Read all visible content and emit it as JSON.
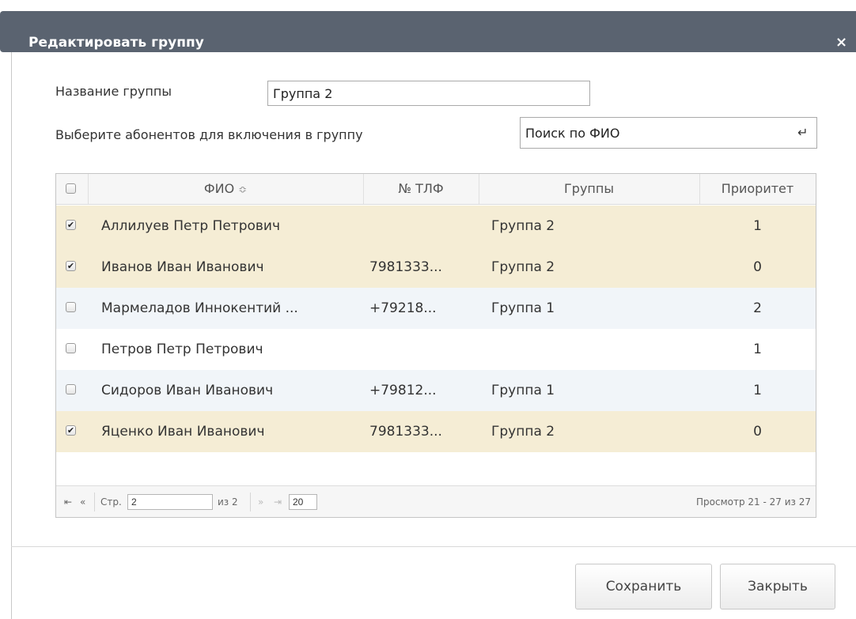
{
  "dialog": {
    "title": "Редактировать группу",
    "close_glyph": "×"
  },
  "form": {
    "group_name_label": "Название группы",
    "group_name_value": "Группа 2",
    "select_label": "Выберите абонентов для включения в группу",
    "search_value": "Поиск по ФИО",
    "enter_icon": "↵"
  },
  "table": {
    "headers": {
      "name": "ФИО",
      "sort_icon": "≎",
      "phone": "№ ТЛФ",
      "groups": "Группы",
      "priority": "Приоритет"
    },
    "rows": [
      {
        "checked": true,
        "name": "Аллилуев Петр Петрович",
        "phone": "",
        "group": "Группа 2",
        "priority": "1"
      },
      {
        "checked": true,
        "name": "Иванов Иван Иванович",
        "phone": "7981333...",
        "group": "Группа 2",
        "priority": "0"
      },
      {
        "checked": false,
        "name": "Мармеладов Иннокентий ...",
        "phone": "+79218...",
        "group": "Группа 1",
        "priority": "2"
      },
      {
        "checked": false,
        "name": "Петров Петр Петрович",
        "phone": "",
        "group": "",
        "priority": "1"
      },
      {
        "checked": false,
        "name": "Сидоров Иван Иванович",
        "phone": "+79812...",
        "group": "Группа 1",
        "priority": "1"
      },
      {
        "checked": true,
        "name": "Яценко Иван Иванович",
        "phone": "7981333...",
        "group": "Группа 2",
        "priority": "0"
      }
    ]
  },
  "pager": {
    "first_icon": "⇤",
    "prev_icon": "«",
    "page_label": "Стр.",
    "page_value": "2",
    "of_label": "из 2",
    "next_icon": "»",
    "last_icon": "⇥",
    "page_size": "20",
    "view_info": "Просмотр 21 - 27 из 27"
  },
  "buttons": {
    "save": "Сохранить",
    "close": "Закрыть"
  },
  "colors": {
    "titlebar": "#5a6370",
    "selected_row": "#f5edd5",
    "alt_row": "#f1f5f9"
  }
}
